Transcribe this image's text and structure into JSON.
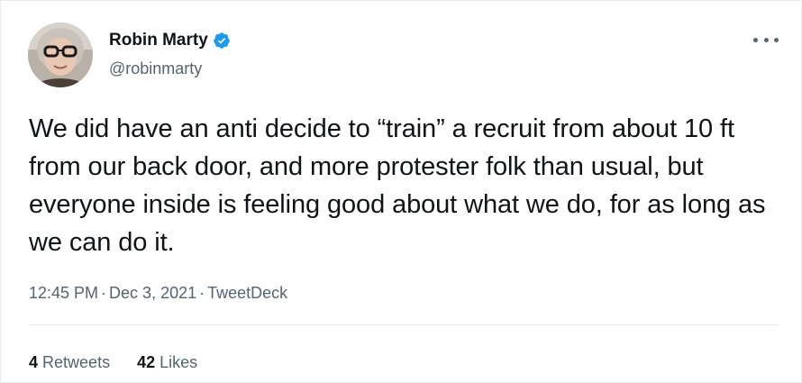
{
  "tweet": {
    "author": {
      "display_name": "Robin Marty",
      "handle": "@robinmarty",
      "verified": true,
      "verified_color": "#1d9bf0"
    },
    "text": "We did have an anti decide to “train” a recruit from about 10 ft from our back door, and more protester folk than usual, but everyone inside is feeling good about what we do, for as long as we can do it.",
    "time": "12:45 PM",
    "date": "Dec 3, 2021",
    "source": "TweetDeck",
    "separator": "·",
    "stats": {
      "retweets_count": "4",
      "retweets_label": "Retweets",
      "likes_count": "42",
      "likes_label": "Likes"
    },
    "more_icon": "more-horizontal-icon"
  }
}
